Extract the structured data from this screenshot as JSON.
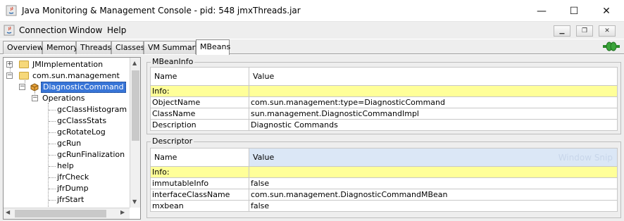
{
  "window": {
    "title": "Java Monitoring & Management Console - pid: 548 jmxThreads.jar",
    "minimize": "—",
    "maximize": "☐",
    "close": "✕"
  },
  "menu": {
    "items": [
      "Connection",
      "Window",
      "Help"
    ],
    "mdi_minimize": "▁",
    "mdi_restore": "❐",
    "mdi_close": "✕"
  },
  "tabs": [
    "Overview",
    "Memory",
    "Threads",
    "Classes",
    "VM Summary",
    "MBeans"
  ],
  "active_tab": "MBeans",
  "tree": {
    "nodes": [
      {
        "label": "JMImplementation",
        "type": "folder",
        "level": 0,
        "expander": "+"
      },
      {
        "label": "com.sun.management",
        "type": "folder",
        "level": 0,
        "expander": "−"
      },
      {
        "label": "DiagnosticCommand",
        "type": "bean",
        "level": 1,
        "expander": "−",
        "selected": true
      },
      {
        "label": "Operations",
        "type": "group",
        "level": 2,
        "expander": "−"
      },
      {
        "label": "gcClassHistogram",
        "type": "leaf",
        "level": 3
      },
      {
        "label": "gcClassStats",
        "type": "leaf",
        "level": 3
      },
      {
        "label": "gcRotateLog",
        "type": "leaf",
        "level": 3
      },
      {
        "label": "gcRun",
        "type": "leaf",
        "level": 3
      },
      {
        "label": "gcRunFinalization",
        "type": "leaf",
        "level": 3
      },
      {
        "label": "help",
        "type": "leaf",
        "level": 3
      },
      {
        "label": "jfrCheck",
        "type": "leaf",
        "level": 3
      },
      {
        "label": "jfrDump",
        "type": "leaf",
        "level": 3
      },
      {
        "label": "jfrStart",
        "type": "leaf",
        "level": 3
      }
    ]
  },
  "mbeaninfo": {
    "title": "MBeanInfo",
    "col_name": "Name",
    "col_value": "Value",
    "info_label": "Info:",
    "rows": [
      {
        "name": "ObjectName",
        "value": "com.sun.management:type=DiagnosticCommand"
      },
      {
        "name": "ClassName",
        "value": "sun.management.DiagnosticCommandImpl"
      },
      {
        "name": "Description",
        "value": "Diagnostic Commands"
      }
    ]
  },
  "descriptor": {
    "title": "Descriptor",
    "col_name": "Name",
    "col_value": "Value",
    "watermark": "Window Snip",
    "info_label": "Info:",
    "rows": [
      {
        "name": "immutableInfo",
        "value": "false"
      },
      {
        "name": "interfaceClassName",
        "value": "com.sun.management.DiagnosticCommandMBean"
      },
      {
        "name": "mxbean",
        "value": "false"
      }
    ]
  },
  "colors": {
    "selection": "#3875d7",
    "info_row": "#ffff99",
    "connect_green": "#3aa53a"
  }
}
